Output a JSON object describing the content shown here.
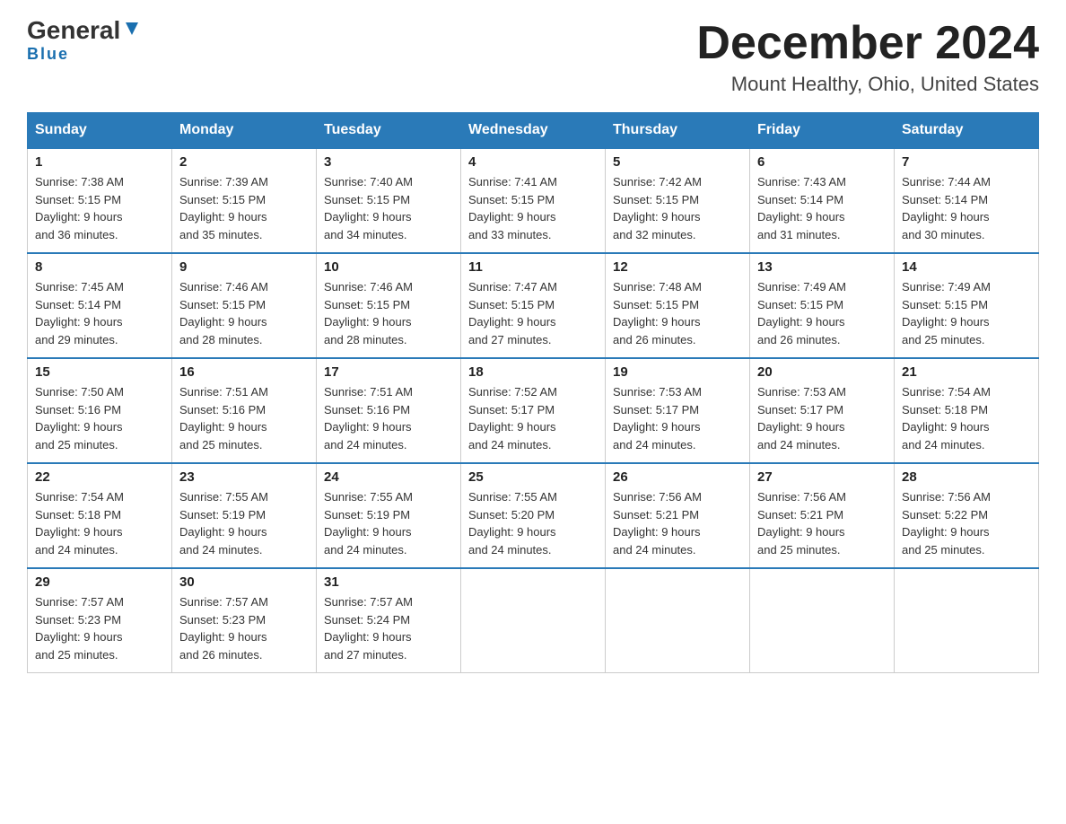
{
  "header": {
    "logo_general": "General",
    "logo_blue": "Blue",
    "title": "December 2024",
    "subtitle": "Mount Healthy, Ohio, United States"
  },
  "weekdays": [
    "Sunday",
    "Monday",
    "Tuesday",
    "Wednesday",
    "Thursday",
    "Friday",
    "Saturday"
  ],
  "weeks": [
    [
      {
        "day": "1",
        "sunrise": "7:38 AM",
        "sunset": "5:15 PM",
        "daylight": "9 hours and 36 minutes."
      },
      {
        "day": "2",
        "sunrise": "7:39 AM",
        "sunset": "5:15 PM",
        "daylight": "9 hours and 35 minutes."
      },
      {
        "day": "3",
        "sunrise": "7:40 AM",
        "sunset": "5:15 PM",
        "daylight": "9 hours and 34 minutes."
      },
      {
        "day": "4",
        "sunrise": "7:41 AM",
        "sunset": "5:15 PM",
        "daylight": "9 hours and 33 minutes."
      },
      {
        "day": "5",
        "sunrise": "7:42 AM",
        "sunset": "5:15 PM",
        "daylight": "9 hours and 32 minutes."
      },
      {
        "day": "6",
        "sunrise": "7:43 AM",
        "sunset": "5:14 PM",
        "daylight": "9 hours and 31 minutes."
      },
      {
        "day": "7",
        "sunrise": "7:44 AM",
        "sunset": "5:14 PM",
        "daylight": "9 hours and 30 minutes."
      }
    ],
    [
      {
        "day": "8",
        "sunrise": "7:45 AM",
        "sunset": "5:14 PM",
        "daylight": "9 hours and 29 minutes."
      },
      {
        "day": "9",
        "sunrise": "7:46 AM",
        "sunset": "5:15 PM",
        "daylight": "9 hours and 28 minutes."
      },
      {
        "day": "10",
        "sunrise": "7:46 AM",
        "sunset": "5:15 PM",
        "daylight": "9 hours and 28 minutes."
      },
      {
        "day": "11",
        "sunrise": "7:47 AM",
        "sunset": "5:15 PM",
        "daylight": "9 hours and 27 minutes."
      },
      {
        "day": "12",
        "sunrise": "7:48 AM",
        "sunset": "5:15 PM",
        "daylight": "9 hours and 26 minutes."
      },
      {
        "day": "13",
        "sunrise": "7:49 AM",
        "sunset": "5:15 PM",
        "daylight": "9 hours and 26 minutes."
      },
      {
        "day": "14",
        "sunrise": "7:49 AM",
        "sunset": "5:15 PM",
        "daylight": "9 hours and 25 minutes."
      }
    ],
    [
      {
        "day": "15",
        "sunrise": "7:50 AM",
        "sunset": "5:16 PM",
        "daylight": "9 hours and 25 minutes."
      },
      {
        "day": "16",
        "sunrise": "7:51 AM",
        "sunset": "5:16 PM",
        "daylight": "9 hours and 25 minutes."
      },
      {
        "day": "17",
        "sunrise": "7:51 AM",
        "sunset": "5:16 PM",
        "daylight": "9 hours and 24 minutes."
      },
      {
        "day": "18",
        "sunrise": "7:52 AM",
        "sunset": "5:17 PM",
        "daylight": "9 hours and 24 minutes."
      },
      {
        "day": "19",
        "sunrise": "7:53 AM",
        "sunset": "5:17 PM",
        "daylight": "9 hours and 24 minutes."
      },
      {
        "day": "20",
        "sunrise": "7:53 AM",
        "sunset": "5:17 PM",
        "daylight": "9 hours and 24 minutes."
      },
      {
        "day": "21",
        "sunrise": "7:54 AM",
        "sunset": "5:18 PM",
        "daylight": "9 hours and 24 minutes."
      }
    ],
    [
      {
        "day": "22",
        "sunrise": "7:54 AM",
        "sunset": "5:18 PM",
        "daylight": "9 hours and 24 minutes."
      },
      {
        "day": "23",
        "sunrise": "7:55 AM",
        "sunset": "5:19 PM",
        "daylight": "9 hours and 24 minutes."
      },
      {
        "day": "24",
        "sunrise": "7:55 AM",
        "sunset": "5:19 PM",
        "daylight": "9 hours and 24 minutes."
      },
      {
        "day": "25",
        "sunrise": "7:55 AM",
        "sunset": "5:20 PM",
        "daylight": "9 hours and 24 minutes."
      },
      {
        "day": "26",
        "sunrise": "7:56 AM",
        "sunset": "5:21 PM",
        "daylight": "9 hours and 24 minutes."
      },
      {
        "day": "27",
        "sunrise": "7:56 AM",
        "sunset": "5:21 PM",
        "daylight": "9 hours and 25 minutes."
      },
      {
        "day": "28",
        "sunrise": "7:56 AM",
        "sunset": "5:22 PM",
        "daylight": "9 hours and 25 minutes."
      }
    ],
    [
      {
        "day": "29",
        "sunrise": "7:57 AM",
        "sunset": "5:23 PM",
        "daylight": "9 hours and 25 minutes."
      },
      {
        "day": "30",
        "sunrise": "7:57 AM",
        "sunset": "5:23 PM",
        "daylight": "9 hours and 26 minutes."
      },
      {
        "day": "31",
        "sunrise": "7:57 AM",
        "sunset": "5:24 PM",
        "daylight": "9 hours and 27 minutes."
      },
      null,
      null,
      null,
      null
    ]
  ],
  "labels": {
    "sunrise": "Sunrise:",
    "sunset": "Sunset:",
    "daylight": "Daylight:"
  }
}
